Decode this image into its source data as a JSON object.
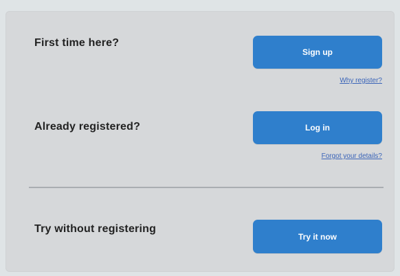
{
  "signup_section": {
    "question": "First time here?",
    "button_label": "Sign up",
    "link_label": "Why register?"
  },
  "login_section": {
    "question": "Already registered?",
    "button_label": "Log in",
    "link_label": "Forgot your details?"
  },
  "trial_section": {
    "question": "Try without registering",
    "button_label": "Try it now"
  },
  "colors": {
    "button": "#2f7fcc",
    "link": "#3a64b8",
    "panel": "#d6d8da",
    "page_background": "#dfe4e6"
  }
}
